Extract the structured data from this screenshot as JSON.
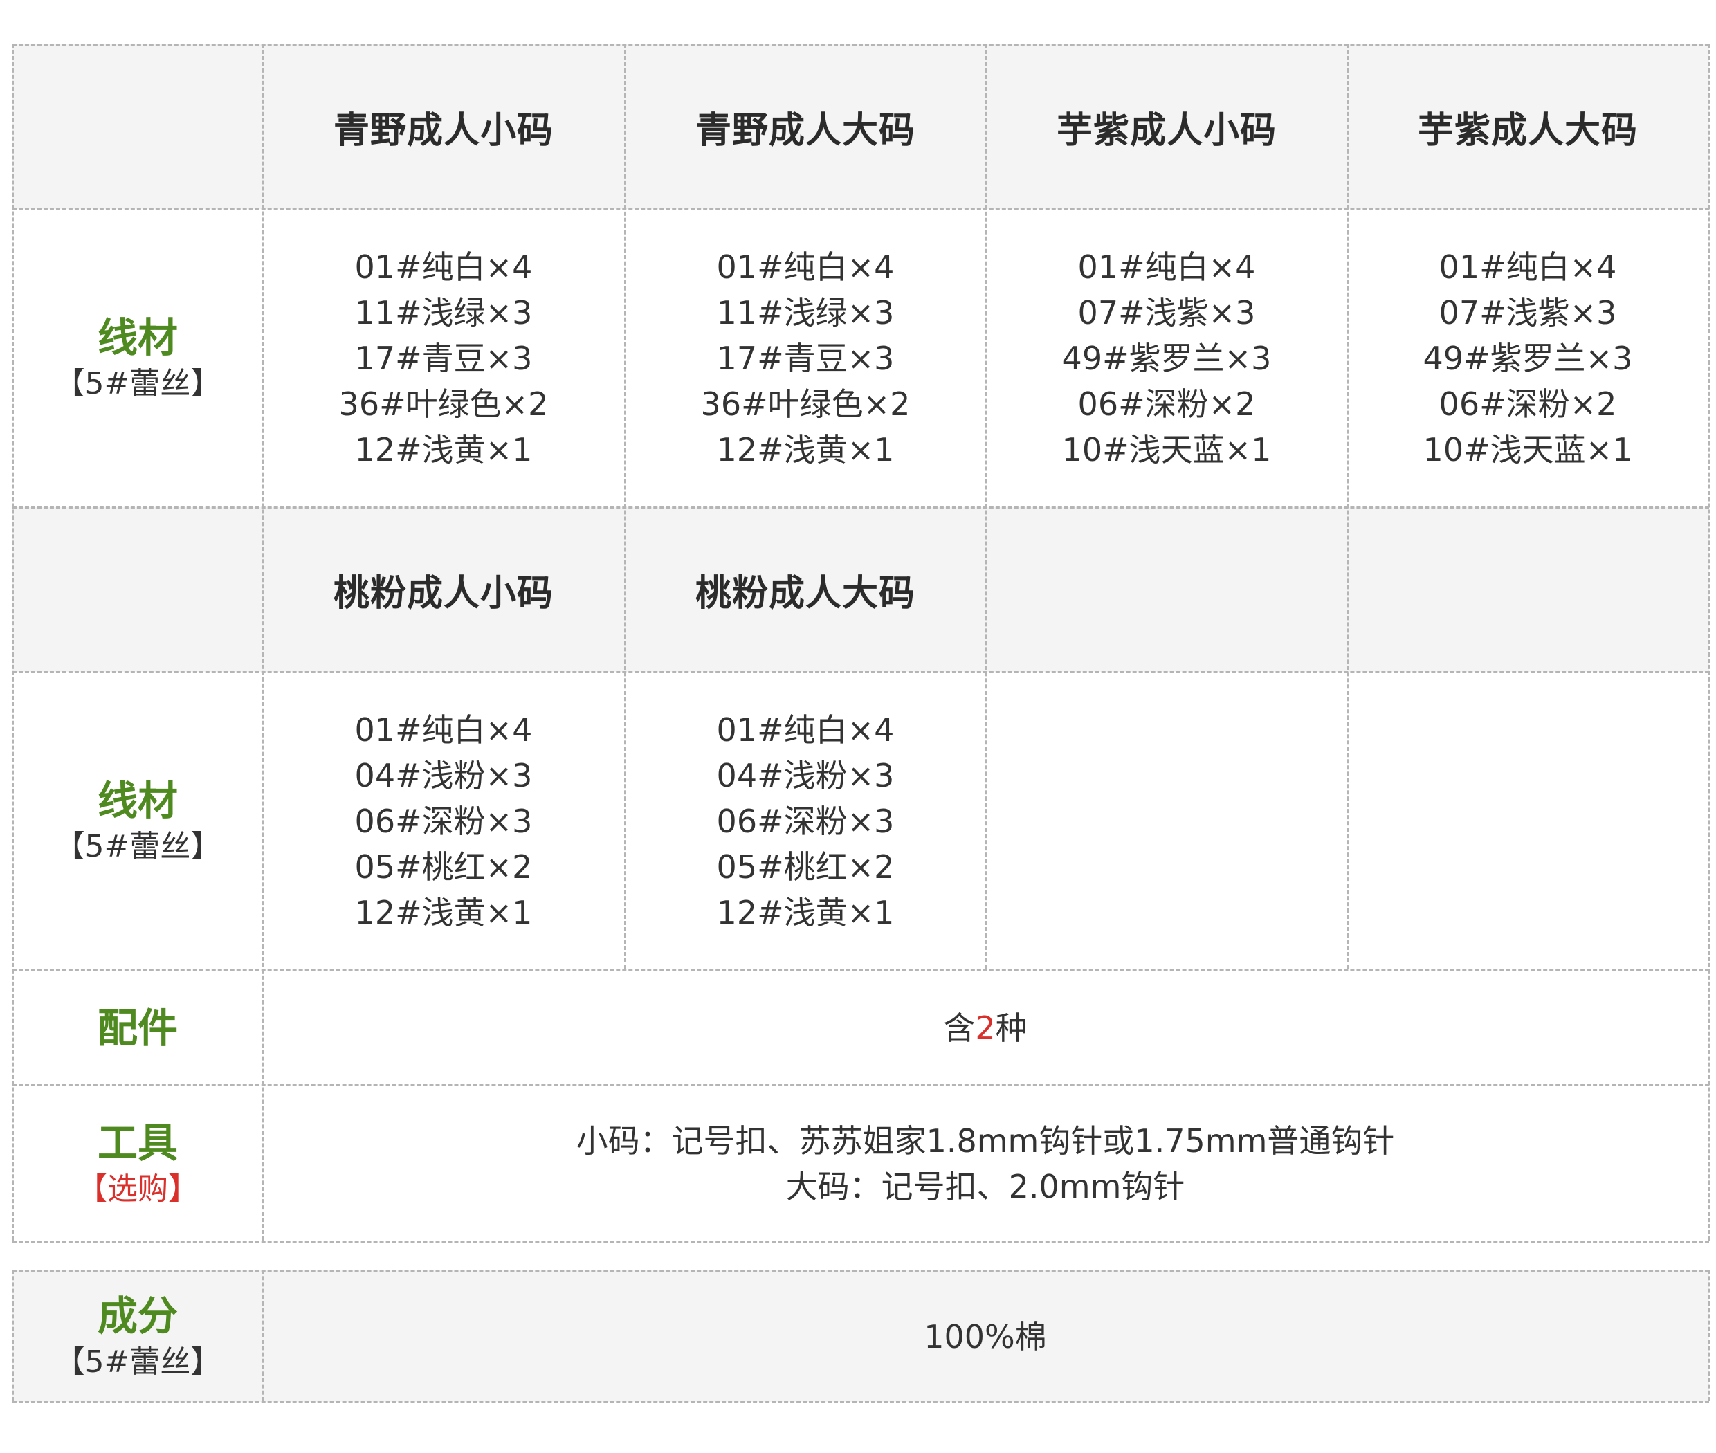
{
  "colors": {
    "label_green": "#4e8a1f",
    "accent_red": "#d9302c",
    "header_bg": "#f4f4f4",
    "grid_line": "#b5b5b5"
  },
  "section1": {
    "headers": [
      "青野成人小码",
      "青野成人大码",
      "芋紫成人小码",
      "芋紫成人大码"
    ],
    "row_label": "线材",
    "row_sub": "【5#蕾丝】",
    "columns": [
      [
        "01#纯白×4",
        "11#浅绿×3",
        "17#青豆×3",
        "36#叶绿色×2",
        "12#浅黄×1"
      ],
      [
        "01#纯白×4",
        "11#浅绿×3",
        "17#青豆×3",
        "36#叶绿色×2",
        "12#浅黄×1"
      ],
      [
        "01#纯白×4",
        "07#浅紫×3",
        "49#紫罗兰×3",
        "06#深粉×2",
        "10#浅天蓝×1"
      ],
      [
        "01#纯白×4",
        "07#浅紫×3",
        "49#紫罗兰×3",
        "06#深粉×2",
        "10#浅天蓝×1"
      ]
    ]
  },
  "section2": {
    "headers": [
      "桃粉成人小码",
      "桃粉成人大码"
    ],
    "row_label": "线材",
    "row_sub": "【5#蕾丝】",
    "columns": [
      [
        "01#纯白×4",
        "04#浅粉×3",
        "06#深粉×3",
        "05#桃红×2",
        "12#浅黄×1"
      ],
      [
        "01#纯白×4",
        "04#浅粉×3",
        "06#深粉×3",
        "05#桃红×2",
        "12#浅黄×1"
      ]
    ]
  },
  "accessories": {
    "label": "配件",
    "prefix": "含",
    "count": "2",
    "suffix": "种"
  },
  "tools": {
    "label": "工具",
    "sub": "【选购】",
    "small": "小码：记号扣、苏苏姐家1.8mm钩针或1.75mm普通钩针",
    "large": "大码：记号扣、2.0mm钩针"
  },
  "composition": {
    "label": "成分",
    "sub": "【5#蕾丝】",
    "value": "100%棉"
  }
}
